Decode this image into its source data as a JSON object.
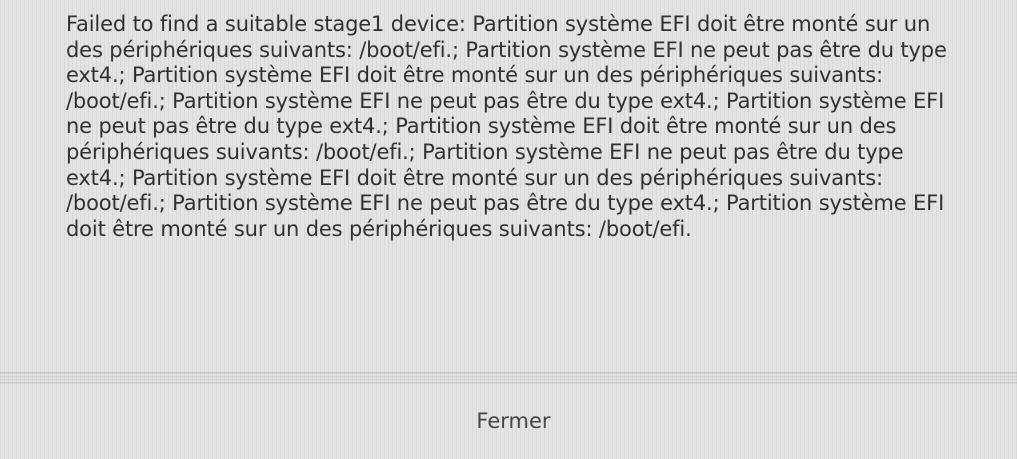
{
  "dialog": {
    "message": "Failed to find a suitable stage1 device: Partition système EFI doit être monté sur un des périphériques suivants: /boot/efi.; Partition système EFI ne peut pas être du type ext4.; Partition système EFI doit être monté sur un des périphériques suivants: /boot/efi.; Partition système EFI ne peut pas être du type ext4.; Partition système EFI ne peut pas être du type ext4.; Partition système EFI doit être monté sur un des périphériques suivants: /boot/efi.; Partition système EFI ne peut pas être du type ext4.; Partition système EFI doit être monté sur un des périphériques suivants: /boot/efi.; Partition système EFI ne peut pas être du type ext4.; Partition système EFI doit être monté sur un des périphériques suivants: /boot/efi.",
    "close_label": "Fermer"
  }
}
